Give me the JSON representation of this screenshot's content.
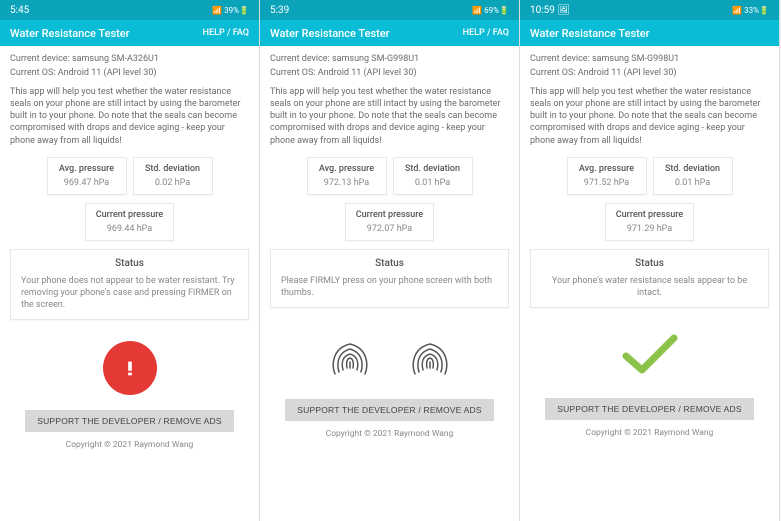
{
  "screens": [
    {
      "status_bar": {
        "time": "5:45",
        "icons": "📶 39%🔋"
      },
      "app_bar": {
        "title": "Water Resistance Tester",
        "help": "HELP / FAQ"
      },
      "device_line": "Current device: samsung SM-A326U1",
      "os_line": "Current OS: Android 11 (API level 30)",
      "description": "This app will help you test whether the water resistance seals on your phone are still intact by using the barometer built in to your phone. Do note that the seals can become compromised with drops and device aging - keep your phone away from all liquids!",
      "avg_pressure": {
        "label": "Avg. pressure",
        "value": "969.47 hPa"
      },
      "std_dev": {
        "label": "Std. deviation",
        "value": "0.02 hPa"
      },
      "current": {
        "label": "Current pressure",
        "value": "969.44 hPa"
      },
      "status": {
        "title": "Status",
        "text": "Your phone does not appear to be water resistant. Try removing your phone's case and pressing FIRMER on the screen."
      },
      "result_icon": "alert",
      "support_btn": "SUPPORT THE DEVELOPER / REMOVE ADS",
      "copyright": "Copyright © 2021 Raymond Wang"
    },
    {
      "status_bar": {
        "time": "5:39",
        "icons": "📶 69%🔋"
      },
      "app_bar": {
        "title": "Water Resistance Tester",
        "help": "HELP / FAQ"
      },
      "device_line": "Current device: samsung SM-G998U1",
      "os_line": "Current OS: Android 11 (API level 30)",
      "description": "This app will help you test whether the water resistance seals on your phone are still intact by using the barometer built in to your phone. Do note that the seals can become compromised with drops and device aging - keep your phone away from all liquids!",
      "avg_pressure": {
        "label": "Avg. pressure",
        "value": "972.13 hPa"
      },
      "std_dev": {
        "label": "Std. deviation",
        "value": "0.01 hPa"
      },
      "current": {
        "label": "Current pressure",
        "value": "972.07 hPa"
      },
      "status": {
        "title": "Status",
        "text": "Please FIRMLY press on your phone screen with both thumbs."
      },
      "result_icon": "fingerprints",
      "support_btn": "SUPPORT THE DEVELOPER / REMOVE ADS",
      "copyright": "Copyright © 2021 Raymond Wang"
    },
    {
      "status_bar": {
        "time": "10:59 🖼",
        "icons": "📶 33%🔋"
      },
      "app_bar": {
        "title": "Water Resistance Tester",
        "help": ""
      },
      "device_line": "Current device: samsung SM-G998U1",
      "os_line": "Current OS: Android 11 (API level 30)",
      "description": "This app will help you test whether the water resistance seals on your phone are still intact by using the barometer built in to your phone. Do note that the seals can become compromised with drops and device aging - keep your phone away from all liquids!",
      "avg_pressure": {
        "label": "Avg. pressure",
        "value": "971.52 hPa"
      },
      "std_dev": {
        "label": "Std. deviation",
        "value": "0.01 hPa"
      },
      "current": {
        "label": "Current pressure",
        "value": "971.29 hPa"
      },
      "status": {
        "title": "Status",
        "text": "Your phone's water resistance seals appear to be intact."
      },
      "result_icon": "check",
      "support_btn": "SUPPORT THE DEVELOPER / REMOVE ADS",
      "copyright": "Copyright © 2021 Raymond Wang"
    }
  ]
}
